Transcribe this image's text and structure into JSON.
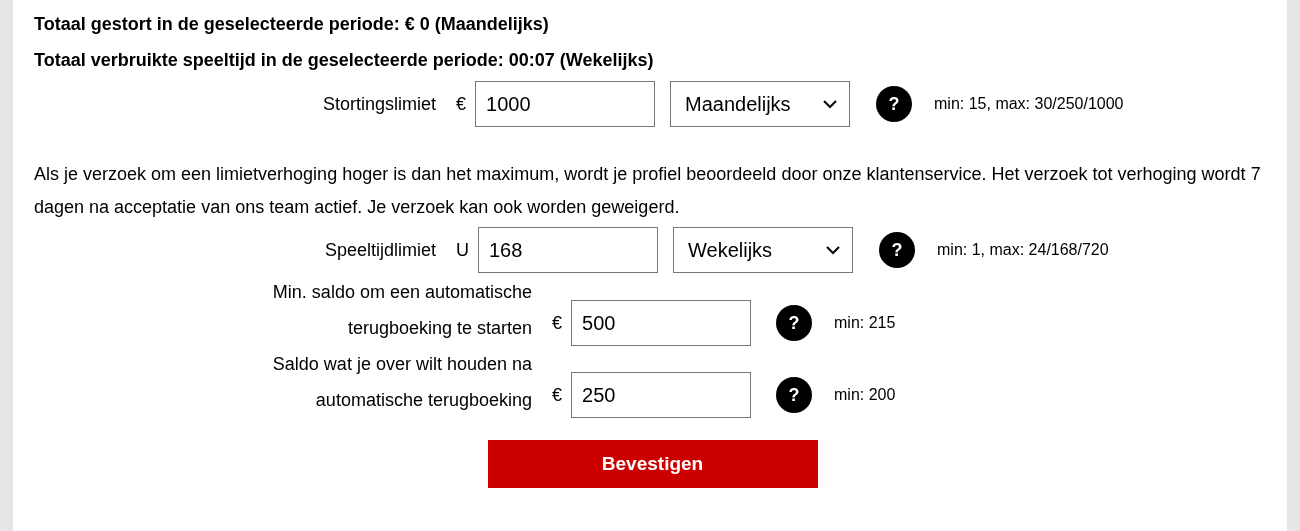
{
  "totals": [
    "Totaal gestort in de geselecteerde periode: € 0 (Maandelijks)",
    "Totaal verbruikte speeltijd in de geselecteerde periode: 00:07 (Wekelijks)"
  ],
  "limits_top": [
    {
      "kind": "select",
      "label": "Stortingslimiet",
      "unit": "€",
      "value": "1000",
      "period": "Maandelijks",
      "hint": "min: 15, max: 30/250/1000"
    }
  ],
  "notice": "Als je verzoek om een limietverhoging hoger is dan het maximum, wordt je profiel beoordeeld door onze klantenservice. Het verzoek tot verhoging wordt 7 dagen na acceptatie van ons team actief. Je verzoek kan ook worden geweigerd.",
  "limits": [
    {
      "kind": "select",
      "label": "Speeltijdlimiet",
      "unit": "U",
      "value": "168",
      "period": "Wekelijks",
      "hint": "min: 1, max: 24/168/720"
    },
    {
      "kind": "plain",
      "label_lines": [
        "Min. saldo om een automatische",
        "terugboeking te starten"
      ],
      "unit": "€",
      "value": "500",
      "hint": "min: 215"
    },
    {
      "kind": "plain",
      "label_lines": [
        "Saldo wat je over wilt houden na",
        "automatische terugboeking"
      ],
      "unit": "€",
      "value": "250",
      "hint": "min: 200"
    }
  ],
  "help_icon": "?",
  "submit": "Bevestigen"
}
